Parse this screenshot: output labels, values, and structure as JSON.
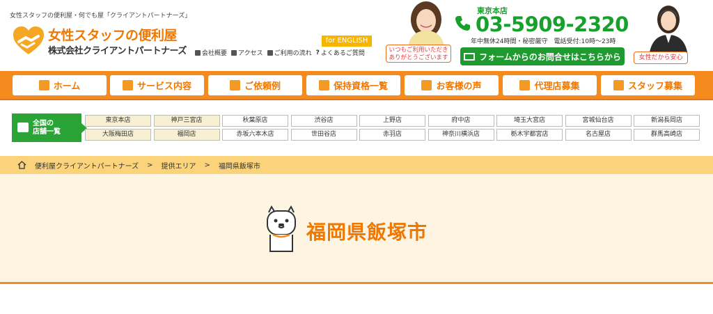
{
  "header": {
    "tagline": "女性スタッフの便利屋・何でも屋「クライアントパートナーズ」",
    "logo_title": "女性スタッフの便利屋",
    "logo_company": "株式会社クライアントパートナーズ",
    "subnav": [
      "会社概要",
      "アクセス",
      "ご利用の流れ",
      "よくあるご質問"
    ],
    "english_label": "for ENGLISH",
    "bubble_left": [
      "いつもご利用いただき",
      "ありがとうございます"
    ],
    "office_label": "東京本店",
    "phone": "03-5909-2320",
    "hours": "年中無休24時間・秘密厳守　電話受付:10時～23時",
    "contact_button": "フォームからのお問合せはこちらから",
    "bubble_right": "女性だから安心"
  },
  "nav": {
    "items": [
      {
        "label": "ホーム",
        "icon": "home-icon"
      },
      {
        "label": "サービス内容",
        "icon": "grid-icon"
      },
      {
        "label": "ご依頼例",
        "icon": "card-icon"
      },
      {
        "label": "保持資格一覧",
        "icon": "id-card-icon"
      },
      {
        "label": "お客様の声",
        "icon": "speech-bubble-icon"
      },
      {
        "label": "代理店募集",
        "icon": "bookmark-icon"
      },
      {
        "label": "スタッフ募集",
        "icon": "person-icon"
      }
    ]
  },
  "branches": {
    "label_line1": "全国の",
    "label_line2": "店舗一覧",
    "row1": [
      "東京本店",
      "神戸三宮店",
      "秋葉原店",
      "渋谷店",
      "上野店",
      "府中店",
      "埼玉大宮店",
      "宮城仙台店",
      "新潟長岡店"
    ],
    "row2": [
      "大阪梅田店",
      "福岡店",
      "赤坂六本木店",
      "世田谷店",
      "赤羽店",
      "神奈川横浜店",
      "栃木宇都宮店",
      "名古屋店",
      "群馬高崎店"
    ],
    "highlighted": [
      "東京本店",
      "神戸三宮店",
      "大阪梅田店",
      "福岡店"
    ]
  },
  "breadcrumb": {
    "items": [
      "便利屋クライアントパートナーズ",
      "提供エリア",
      "福岡県飯塚市"
    ],
    "separator": ">"
  },
  "hero": {
    "title": "福岡県飯塚市"
  },
  "colors": {
    "orange": "#f58b1f",
    "green": "#1e9a31",
    "breadcrumb_bg": "#fbd37b",
    "hero_bg": "#fdf5e2"
  }
}
